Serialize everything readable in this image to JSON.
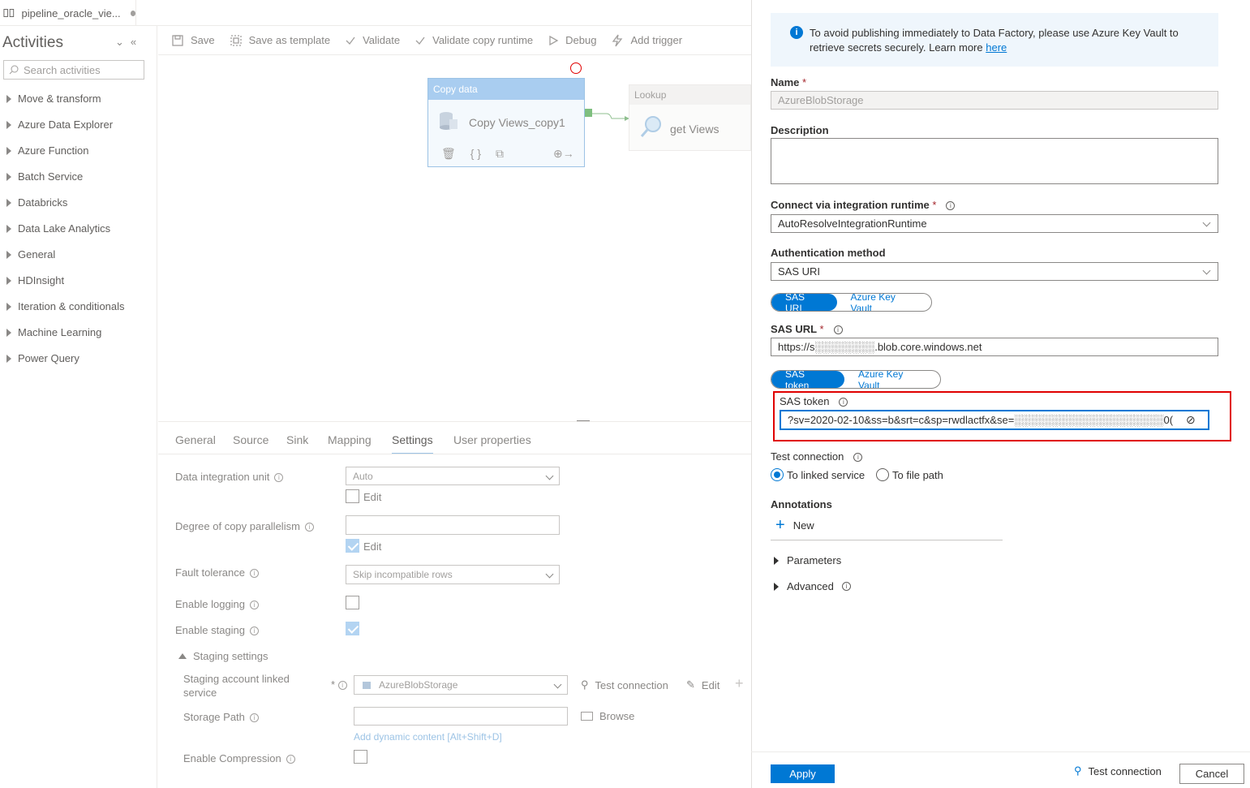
{
  "tab": {
    "title": "pipeline_oracle_vie..."
  },
  "activities": {
    "title": "Activities",
    "search_placeholder": "Search activities",
    "categories": [
      "Move & transform",
      "Azure Data Explorer",
      "Azure Function",
      "Batch Service",
      "Databricks",
      "Data Lake Analytics",
      "General",
      "HDInsight",
      "Iteration & conditionals",
      "Machine Learning",
      "Power Query"
    ]
  },
  "toolbar": {
    "save": "Save",
    "save_template": "Save as template",
    "validate": "Validate",
    "validate_copy": "Validate copy runtime",
    "debug": "Debug",
    "add_trigger": "Add trigger"
  },
  "canvas": {
    "copy": {
      "type": "Copy data",
      "name": "Copy Views_copy1"
    },
    "lookup": {
      "type": "Lookup",
      "name": "get Views"
    }
  },
  "bottom_tabs": [
    "General",
    "Source",
    "Sink",
    "Mapping",
    "Settings",
    "User properties"
  ],
  "active_bottom_tab": "Settings",
  "settings": {
    "diu_label": "Data integration unit",
    "diu_value": "Auto",
    "edit": "Edit",
    "parallel_label": "Degree of copy parallelism",
    "fault_label": "Fault tolerance",
    "fault_value": "Skip incompatible rows",
    "logging_label": "Enable logging",
    "staging_label": "Enable staging",
    "staging_settings": "Staging settings",
    "staging_account_label": "Staging account linked service",
    "staging_account_value": "AzureBlobStorage",
    "test_connection": "Test connection",
    "edit_link": "Edit",
    "storage_path_label": "Storage Path",
    "browse": "Browse",
    "dynamic": "Add dynamic content [Alt+Shift+D]",
    "compression_label": "Enable Compression"
  },
  "panel": {
    "info_text": "To avoid publishing immediately to Data Factory, please use Azure Key Vault to retrieve secrets securely. Learn more ",
    "info_link": "here",
    "name_label": "Name",
    "name_value": "AzureBlobStorage",
    "description_label": "Description",
    "runtime_label": "Connect via integration runtime",
    "runtime_value": "AutoResolveIntegrationRuntime",
    "auth_label": "Authentication method",
    "auth_value": "SAS URI",
    "toggle1": [
      "SAS URI",
      "Azure Key Vault"
    ],
    "sas_url_label": "SAS URL",
    "sas_url_value": "https://s░░░░░░░░.blob.core.windows.net",
    "toggle2": [
      "SAS token",
      "Azure Key Vault"
    ],
    "sas_token_label": "SAS token",
    "sas_token_value": "?sv=2020-02-10&ss=b&srt=c&sp=rwdlactfx&se=░░░░░░░░░░░░░░░░░░░░0(",
    "test_label": "Test connection",
    "radio1": "To linked service",
    "radio2": "To file path",
    "annotations_label": "Annotations",
    "new": "New",
    "parameters": "Parameters",
    "advanced": "Advanced",
    "apply": "Apply",
    "test_connection_btn": "Test connection",
    "cancel": "Cancel"
  },
  "colors": {
    "accent": "#0078d4",
    "highlight_border": "#e00000"
  }
}
